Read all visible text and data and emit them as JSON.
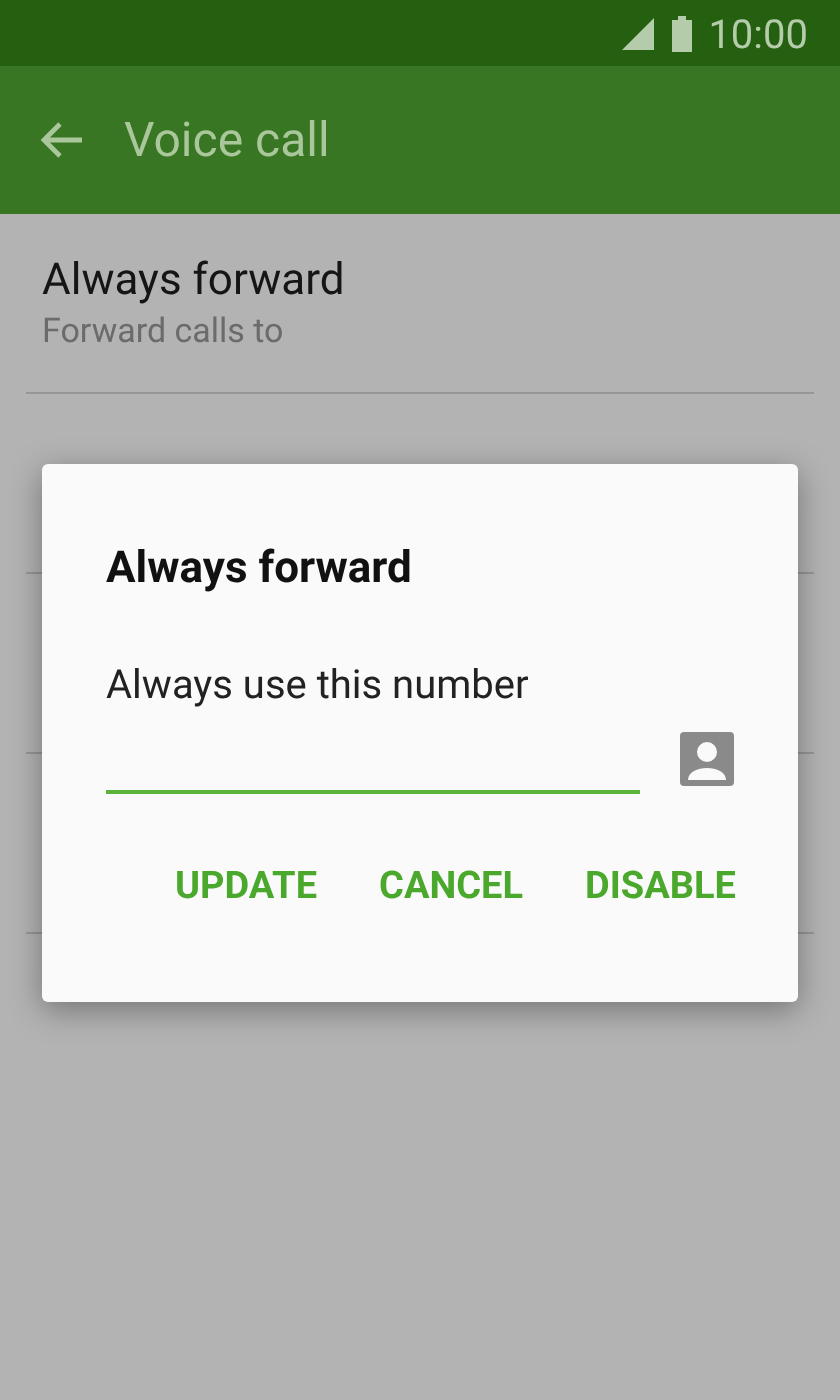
{
  "status_bar": {
    "time": "10:00"
  },
  "app_bar": {
    "title": "Voice call"
  },
  "settings": [
    {
      "title": "Always forward",
      "subtitle": "Forward calls to"
    }
  ],
  "dialog": {
    "title": "Always forward",
    "label": "Always use this number",
    "buttons": [
      "UPDATE",
      "CANCEL",
      "DISABLE"
    ]
  }
}
